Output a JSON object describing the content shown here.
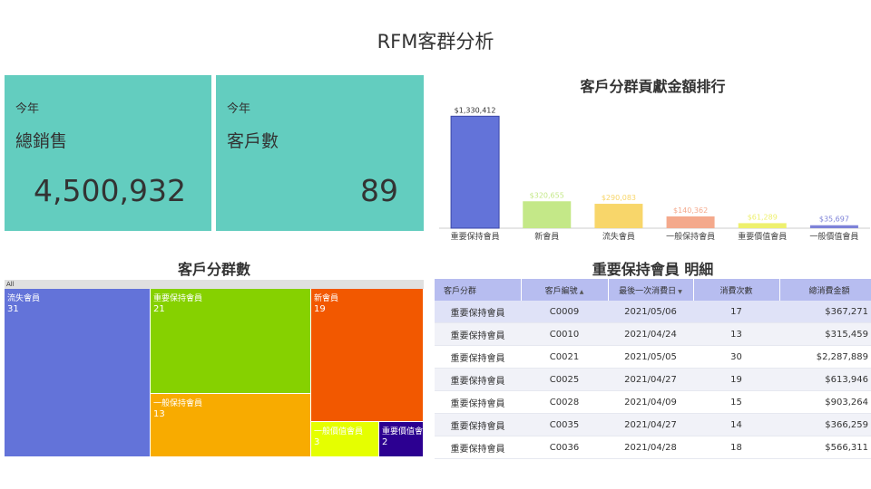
{
  "page_title": "RFM客群分析",
  "kpis": [
    {
      "period": "今年",
      "label": "總銷售",
      "value": "4,500,932"
    },
    {
      "period": "今年",
      "label": "客戶數",
      "value": "89"
    }
  ],
  "colors": {
    "kpi_bg": "#63cdbf",
    "bar_bg": "#6373d9",
    "table_header": "#b7bdf0"
  },
  "chart_data": [
    {
      "type": "bar",
      "title": "客戶分群貢獻金額排行",
      "categories": [
        "重要保持會員",
        "新會員",
        "流失會員",
        "一般保持會員",
        "重要價值會員",
        "一般價值會員"
      ],
      "values": [
        1330412,
        320000,
        290000,
        140000,
        60000,
        35000
      ],
      "data_labels": [
        "$1,330,412",
        "$320,655",
        "$290,083",
        "$140,362",
        "$61,289",
        "$35,697"
      ],
      "colors": [
        "#6373d9",
        "#c4e888",
        "#f8d66a",
        "#f4a98c",
        "#eef06e",
        "#7d82d8"
      ],
      "ylim": [
        0,
        1420000
      ],
      "grid": false,
      "legend": "none"
    },
    {
      "type": "treemap",
      "title": "客戶分群數",
      "root_label": "All",
      "items": [
        {
          "name": "流失會員",
          "value": 31,
          "color": "#6373d9"
        },
        {
          "name": "重要保持會員",
          "value": 21,
          "color": "#86d100"
        },
        {
          "name": "新會員",
          "value": 19,
          "color": "#f25800"
        },
        {
          "name": "一般保持會員",
          "value": 13,
          "color": "#f8ab00"
        },
        {
          "name": "一般價值會員",
          "value": 3,
          "color": "#e5ff00"
        },
        {
          "name": "重要價值會員",
          "value": 2,
          "color": "#2c0091"
        }
      ]
    },
    {
      "type": "table",
      "title": "重要保持會員 明細",
      "columns": [
        "客戶分群",
        "客戶編號",
        "最後一次消費日",
        "消費次數",
        "總消費金額"
      ],
      "rows": [
        [
          "重要保持會員",
          "C0009",
          "2021/05/06",
          "17",
          "$367,271"
        ],
        [
          "重要保持會員",
          "C0010",
          "2021/04/24",
          "13",
          "$315,459"
        ],
        [
          "重要保持會員",
          "C0021",
          "2021/05/05",
          "30",
          "$2,287,889"
        ],
        [
          "重要保持會員",
          "C0025",
          "2021/04/27",
          "19",
          "$613,946"
        ],
        [
          "重要保持會員",
          "C0028",
          "2021/04/09",
          "15",
          "$903,264"
        ],
        [
          "重要保持會員",
          "C0035",
          "2021/04/27",
          "14",
          "$366,259"
        ],
        [
          "重要保持會員",
          "C0036",
          "2021/04/28",
          "18",
          "$566,311"
        ]
      ]
    }
  ]
}
